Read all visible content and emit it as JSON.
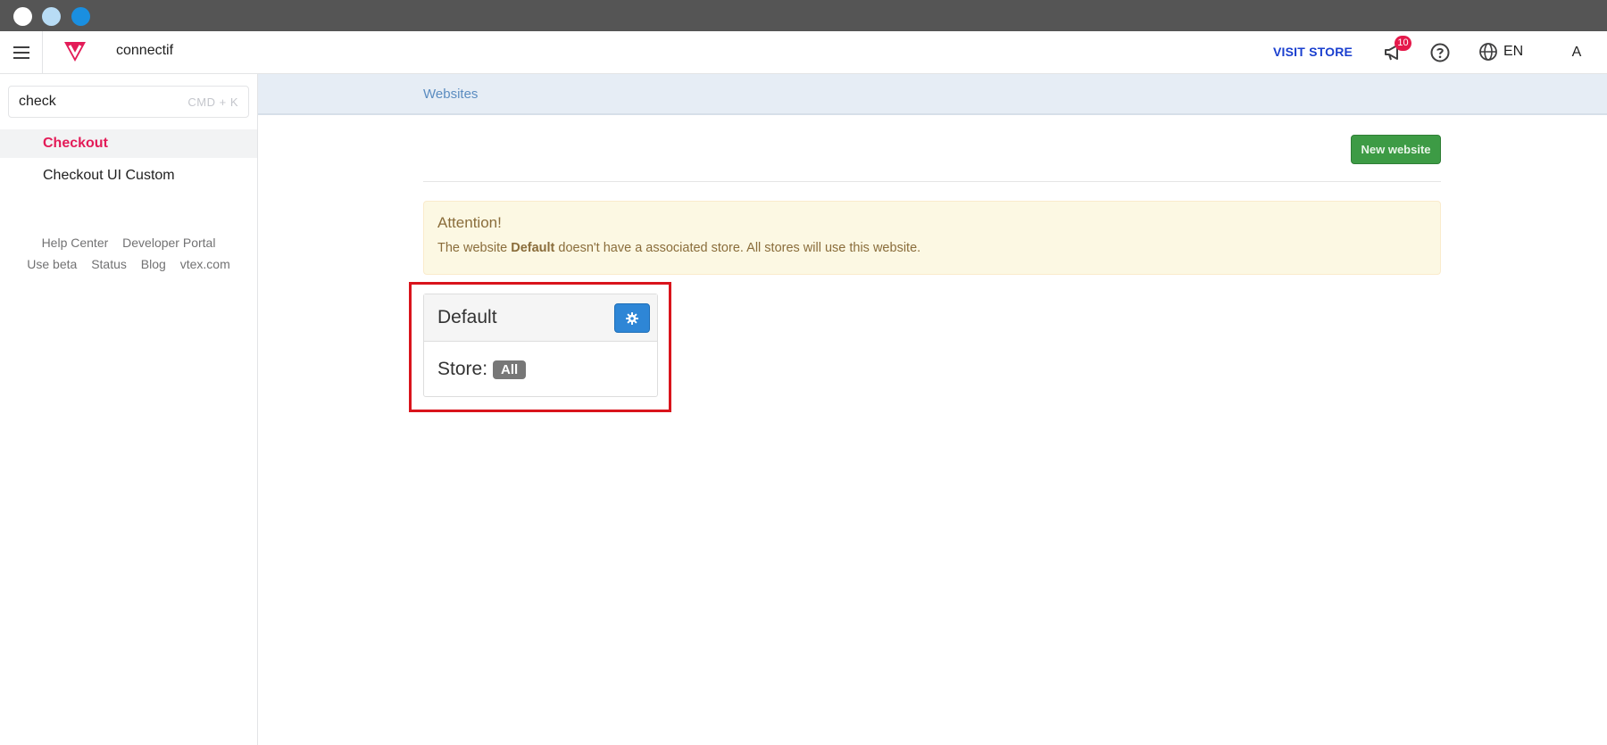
{
  "topbar": {
    "account_name": "connectif",
    "visit_store_label": "VISIT STORE",
    "notification_count": "10",
    "language_label": "EN",
    "avatar_initial": "A"
  },
  "sidebar": {
    "search": {
      "value": "check",
      "shortcut_hint": "CMD + K"
    },
    "items": [
      {
        "label": "Checkout",
        "active": true
      },
      {
        "label": "Checkout UI Custom",
        "active": false
      }
    ],
    "footer_links": [
      "Help Center",
      "Developer Portal",
      "Use beta",
      "Status",
      "Blog",
      "vtex.com"
    ]
  },
  "main": {
    "breadcrumb": "Websites",
    "new_website_label": "New website",
    "alert": {
      "title": "Attention!",
      "text_before": "The website ",
      "website_name": "Default",
      "text_after": " doesn't have a associated store. All stores will use this website."
    },
    "website_panel": {
      "title": "Default",
      "store_label": "Store:",
      "store_badge": "All"
    }
  },
  "colors": {
    "brand": "#e31c58",
    "visit_store": "#1a3fcf",
    "new_website_bg": "#3d9b45",
    "gear_button_bg": "#2e86d6",
    "alert_bg": "#fcf8e3",
    "highlight_box": "#d9141c"
  },
  "icons": {
    "menu": "hamburger-icon",
    "logo": "vtex-logo",
    "notifications": "megaphone-icon",
    "help": "question-circle-icon",
    "language": "globe-icon",
    "settings": "gear-icon"
  }
}
